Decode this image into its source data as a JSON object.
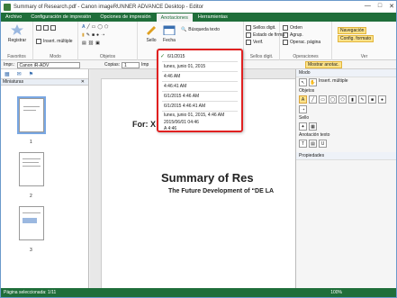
{
  "window": {
    "title": "Summary of Research.pdf - Canon imageRUNNER ADVANCE Desktop - Editor",
    "controls": [
      "—",
      "□",
      "✕"
    ]
  },
  "tabs": [
    "Archivo",
    "Configuración de impresión",
    "Opciones de impresión",
    "Anotaciones",
    "Herramientas"
  ],
  "ribbon": {
    "favoritos": {
      "label": "Favoritos",
      "registrar": "Registrar"
    },
    "modo": {
      "label": "Modo",
      "insert_multiple": "Insert. múltiple"
    },
    "objetos": {
      "label": "Objetos"
    },
    "sello": {
      "label": "Sello",
      "sello_btn": "Sello",
      "fecha_btn": "Fecha",
      "busqueda": "Búsqueda texto"
    },
    "sellos": {
      "sellos_digit": "Sellos digit.",
      "estado_firma": "Estado de firma",
      "verif": "Verif.",
      "label": "Sellos digit."
    },
    "operaciones": {
      "orden": "Orden",
      "agrup": "Agrup.",
      "operac_pagina": "Operac. página",
      "label": "Operaciones"
    },
    "ver": {
      "navegacion": "Navegación",
      "config_formato": "Config. formato",
      "label": "Ver"
    }
  },
  "toolbar2": {
    "imprimir_label": "Impr.:",
    "printer": "Canon iR-ADV",
    "copias_label": "Copias:",
    "copias": "1",
    "imp_label": "Imp",
    "mostrar_anotac": "Mostrar anotac."
  },
  "left_pane": {
    "title": "Miniaturas",
    "pages": [
      "1",
      "2",
      "3"
    ]
  },
  "document": {
    "for_line": "For: X",
    "heading": "Summary of Res",
    "subheading": "The Future Development of “DE LA"
  },
  "right_pane": {
    "modo": "Modo",
    "insert_multiple": "Insert. múltiple",
    "objetos": "Objetos",
    "sello": "Sello",
    "anotacion_texto": "Anotación texto",
    "propiedades": "Propiedades"
  },
  "status": {
    "pages": "Página seleccionada: 1/11",
    "zoom": "100%"
  },
  "date_dropdown": {
    "items": [
      "6/1/2015",
      "lunes, junio 01, 2015",
      "4:46 AM",
      "4:46:41 AM",
      "6/1/2015 4:46 AM",
      "6/1/2015 4:46:41 AM",
      "lunes, junio 01, 2015, 4:46 AM",
      "2015/06/01 04:46",
      "A 4:46"
    ]
  },
  "colors": {
    "accent": "#1f6e3a",
    "highlight": "#fde38a",
    "callout": "#e02020"
  }
}
